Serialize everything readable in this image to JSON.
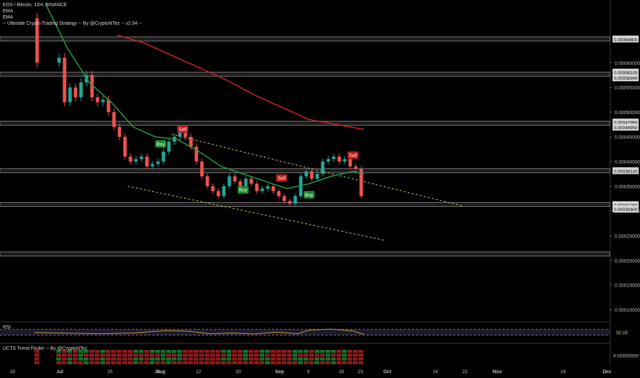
{
  "chart_data": {
    "type": "candlestick",
    "symbol_line": "EOS / Bitcoin, 12H, BINANCE",
    "indicator_labels": [
      "EMA",
      "EMA",
      "-- Ultimate Crypto Trading Strategy -- By @CryptoNTez -- v2.04 --"
    ],
    "y_axis_ticks": [
      "0.00060000",
      "0.00055000",
      "0.00050000",
      "0.00045000",
      "0.00040000",
      "0.00035000",
      "0.00030000",
      "0.00025000",
      "0.00020000",
      "0.00015000",
      "0.00010000"
    ],
    "price_markers": [
      "0.00064800",
      "0.00058100",
      "0.00056940",
      "0.00047990",
      "0.00046950",
      "0.00038140",
      "0.00031260",
      "0.00030400"
    ],
    "x_axis_ticks": [
      "18",
      "Jul",
      "15",
      "23",
      "Aug",
      "12",
      "20",
      "Sep",
      "9",
      "16",
      "23",
      "Oct",
      "14",
      "22",
      "Nov",
      "19",
      "Dec"
    ],
    "support_resistance_levels": [
      0.000648,
      0.0005766,
      0.0004775,
      0.0003814,
      0.000313,
      0.0002128
    ],
    "price_path": [
      [
        0,
        0.00069
      ],
      [
        4,
        0.0006
      ],
      [
        5,
        0.00061
      ],
      [
        6,
        0.00052
      ],
      [
        7,
        0.00055
      ],
      [
        8,
        0.00053
      ],
      [
        9,
        0.00056
      ],
      [
        10,
        0.000575
      ],
      [
        11,
        0.00053
      ],
      [
        12,
        0.00052
      ],
      [
        13,
        0.000525
      ],
      [
        14,
        0.0005
      ],
      [
        15,
        0.00047
      ],
      [
        16,
        0.00045
      ],
      [
        17,
        0.00041
      ],
      [
        18,
        0.0004
      ],
      [
        19,
        0.000405
      ],
      [
        20,
        0.00041
      ],
      [
        21,
        0.00039
      ],
      [
        22,
        0.000395
      ],
      [
        23,
        0.0004
      ],
      [
        24,
        0.00042
      ],
      [
        25,
        0.00044
      ],
      [
        26,
        0.00045
      ],
      [
        27,
        0.00046
      ],
      [
        28,
        0.00045
      ],
      [
        29,
        0.00043
      ],
      [
        30,
        0.0004
      ],
      [
        31,
        0.00037
      ],
      [
        32,
        0.00035
      ],
      [
        33,
        0.00034
      ],
      [
        34,
        0.00033
      ],
      [
        35,
        0.00035
      ],
      [
        36,
        0.00037
      ],
      [
        37,
        0.00036
      ],
      [
        38,
        0.00035
      ],
      [
        39,
        0.000365
      ],
      [
        40,
        0.000355
      ],
      [
        41,
        0.00034
      ],
      [
        42,
        0.000345
      ],
      [
        43,
        0.00035
      ],
      [
        44,
        0.00034
      ],
      [
        45,
        0.00033
      ],
      [
        46,
        0.00032
      ],
      [
        47,
        0.000315
      ],
      [
        48,
        0.00033
      ],
      [
        49,
        0.00037
      ],
      [
        50,
        0.00038
      ],
      [
        51,
        0.000365
      ],
      [
        52,
        0.000375
      ],
      [
        53,
        0.0004
      ],
      [
        54,
        0.000405
      ],
      [
        55,
        0.00041
      ],
      [
        56,
        0.0004
      ],
      [
        57,
        0.000405
      ],
      [
        58,
        0.00039
      ],
      [
        59,
        0.000385
      ],
      [
        60,
        0.00033
      ]
    ],
    "ema_fast": [
      [
        2,
        0.00072
      ],
      [
        6,
        0.00063
      ],
      [
        10,
        0.00056
      ],
      [
        14,
        0.00052
      ],
      [
        18,
        0.00047
      ],
      [
        22,
        0.00045
      ],
      [
        26,
        0.000445
      ],
      [
        30,
        0.00042
      ],
      [
        34,
        0.00039
      ],
      [
        38,
        0.000375
      ],
      [
        42,
        0.00036
      ],
      [
        46,
        0.000345
      ],
      [
        50,
        0.000355
      ],
      [
        54,
        0.00037
      ],
      [
        58,
        0.00038
      ],
      [
        60,
        0.000375
      ]
    ],
    "ema_slow": [
      [
        15,
        0.000656
      ],
      [
        20,
        0.00064
      ],
      [
        25,
        0.000615
      ],
      [
        30,
        0.00059
      ],
      [
        35,
        0.000565
      ],
      [
        40,
        0.000535
      ],
      [
        45,
        0.00051
      ],
      [
        50,
        0.000485
      ],
      [
        55,
        0.000475
      ],
      [
        60,
        0.000465
      ]
    ],
    "channel_upper": [
      [
        25,
        0.000455
      ],
      [
        78,
        0.00031
      ]
    ],
    "channel_lower": [
      [
        17,
        0.00035
      ],
      [
        64,
        0.00024
      ]
    ],
    "signals": [
      {
        "label": "Buy",
        "type": "buy",
        "x": 23,
        "price": 0.000435
      },
      {
        "label": "Sell",
        "type": "sell",
        "x": 27,
        "price": 0.000465
      },
      {
        "label": "Buy",
        "type": "buy",
        "x": 38,
        "price": 0.000342
      },
      {
        "label": "Sell",
        "type": "sell",
        "x": 45,
        "price": 0.000366
      },
      {
        "label": "Buy",
        "type": "buy",
        "x": 50,
        "price": 0.000332
      },
      {
        "label": "Sell",
        "type": "sell",
        "x": 58,
        "price": 0.000412
      }
    ],
    "rsi": {
      "label": "RSI",
      "value_label": "50.00",
      "upper_band": 70,
      "lower_band": 30,
      "values": [
        [
          0,
          48
        ],
        [
          6,
          44
        ],
        [
          12,
          40
        ],
        [
          18,
          45
        ],
        [
          24,
          62
        ],
        [
          28,
          58
        ],
        [
          32,
          40
        ],
        [
          36,
          45
        ],
        [
          40,
          38
        ],
        [
          44,
          52
        ],
        [
          48,
          40
        ],
        [
          50,
          65
        ],
        [
          54,
          72
        ],
        [
          58,
          60
        ],
        [
          60,
          35
        ]
      ]
    },
    "trend_finder": {
      "label": "UCTS Trend Finder -- By @CryptoNTez",
      "value_label": "4.00000000",
      "rows": 4
    },
    "colors": {
      "up": "#26a69a",
      "down": "#ef5350",
      "ema_fast": "#1f9a3f",
      "ema_slow": "#cc2222",
      "channel": "#d6c64a",
      "level_band": "#777777",
      "buy": "#1b8a2a",
      "sell": "#b71c1c",
      "rsi_line": "#c9a227",
      "axis_text": "#bbbbbb"
    }
  }
}
